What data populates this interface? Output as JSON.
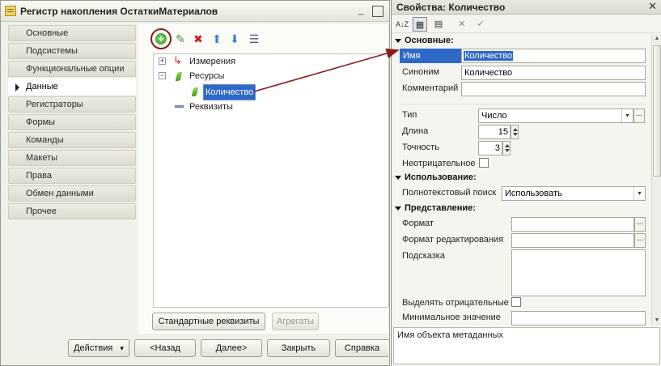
{
  "window": {
    "title": "Регистр накопления ОстаткиМатериалов",
    "minimize": "_",
    "maximize": "□",
    "close": "✕"
  },
  "nav": {
    "items": [
      {
        "label": "Основные"
      },
      {
        "label": "Подсистемы"
      },
      {
        "label": "Функциональные опции"
      },
      {
        "label": "Данные",
        "active": true
      },
      {
        "label": "Регистраторы"
      },
      {
        "label": "Формы"
      },
      {
        "label": "Команды"
      },
      {
        "label": "Макеты"
      },
      {
        "label": "Права"
      },
      {
        "label": "Обмен данными"
      },
      {
        "label": "Прочее"
      }
    ]
  },
  "toolbar": {
    "add_icon": "add-icon",
    "add_glyph": "+",
    "edit_glyph": "✎",
    "delete_glyph": "✖",
    "up_glyph": "⬆",
    "down_glyph": "⬇",
    "sort_glyph": "☰"
  },
  "tree": {
    "dimensions": {
      "label": "Измерения",
      "expander": "+"
    },
    "resources": {
      "label": "Ресурсы",
      "expander": "−"
    },
    "resource_item": {
      "label": "Количество"
    },
    "attributes": {
      "label": "Реквизиты"
    }
  },
  "content_buttons": {
    "standard_attributes": "Стандартные реквизиты",
    "aggregates": "Агрегаты"
  },
  "footer": {
    "actions": "Действия",
    "actions_arrow": "▾",
    "back": "<Назад",
    "next": "Далее>",
    "close": "Закрыть",
    "help": "Справка"
  },
  "properties": {
    "title": "Свойства: Количество",
    "close": "✕",
    "toolbar": {
      "sort_az": "A↓Z",
      "categories": "▦",
      "filter": "▤",
      "delete": "✕",
      "ok": "✔"
    },
    "sections": {
      "main": "Основные:",
      "usage": "Использование:",
      "presentation": "Представление:"
    },
    "fields": {
      "name": {
        "label": "Имя",
        "value": "Количество"
      },
      "synonym": {
        "label": "Синоним",
        "value": "Количество"
      },
      "comment": {
        "label": "Комментарий",
        "value": ""
      },
      "type": {
        "label": "Тип",
        "value": "Число",
        "arrow": "▾",
        "dots": "..."
      },
      "length": {
        "label": "Длина",
        "value": "15"
      },
      "precision": {
        "label": "Точность",
        "value": "3"
      },
      "non_negative": {
        "label": "Неотрицательное",
        "checked": false
      },
      "fulltext_search": {
        "label": "Полнотекстовый поиск",
        "value": "Использовать",
        "arrow": "▾"
      },
      "format": {
        "label": "Формат",
        "value": "",
        "dots": "..."
      },
      "edit_format": {
        "label": "Формат редактирования",
        "value": "",
        "dots": "..."
      },
      "tooltip": {
        "label": "Подсказка",
        "value": ""
      },
      "highlight_negative": {
        "label": "Выделять отрицательные",
        "checked": false
      },
      "min_value": {
        "label": "Минимальное значение",
        "value": ""
      }
    },
    "description": "Имя объекта метаданных",
    "scroll_up": "▲",
    "scroll_down": "▼"
  },
  "colors": {
    "selection": "#2f69c8",
    "annotation": "#8b1a1a"
  }
}
